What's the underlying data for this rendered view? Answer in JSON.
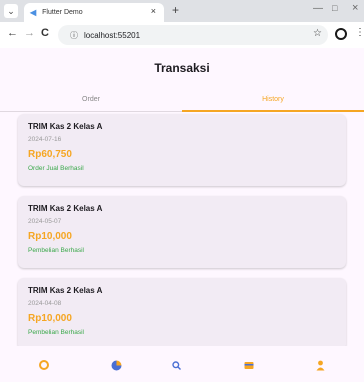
{
  "browser": {
    "tab_title": "Flutter Demo",
    "tab_favicon": "flutter-icon",
    "tab_close": "×",
    "new_tab": "+",
    "url": "localhost:55201",
    "win_minimize": "—",
    "win_maximize": "□",
    "win_close": "×",
    "back": "←",
    "forward": "→",
    "reload": "C",
    "info": "ⓘ",
    "star": "☆",
    "kebab": "⋮",
    "menu": "⌄"
  },
  "app": {
    "title": "Transaksi",
    "tabs": [
      {
        "label": "Order",
        "active": false
      },
      {
        "label": "History",
        "active": true
      }
    ],
    "accent_color": "#f5a623",
    "success_color": "#3aa84a",
    "transactions": [
      {
        "title": "TRIM Kas 2 Kelas A",
        "date": "2024-07-16",
        "price": "Rp60,750",
        "status": "Order Jual Berhasil"
      },
      {
        "title": "TRIM Kas 2 Kelas A",
        "date": "2024-05-07",
        "price": "Rp10,000",
        "status": "Pembelian Berhasil"
      },
      {
        "title": "TRIM Kas 2 Kelas A",
        "date": "2024-04-08",
        "price": "Rp10,000",
        "status": "Pembelian Berhasil"
      }
    ],
    "bottom_nav": [
      {
        "icon": "home-icon",
        "active": true
      },
      {
        "icon": "chart-icon",
        "active": false
      },
      {
        "icon": "search-icon",
        "active": false
      },
      {
        "icon": "wallet-icon",
        "active": false
      },
      {
        "icon": "profile-icon",
        "active": false
      }
    ]
  }
}
